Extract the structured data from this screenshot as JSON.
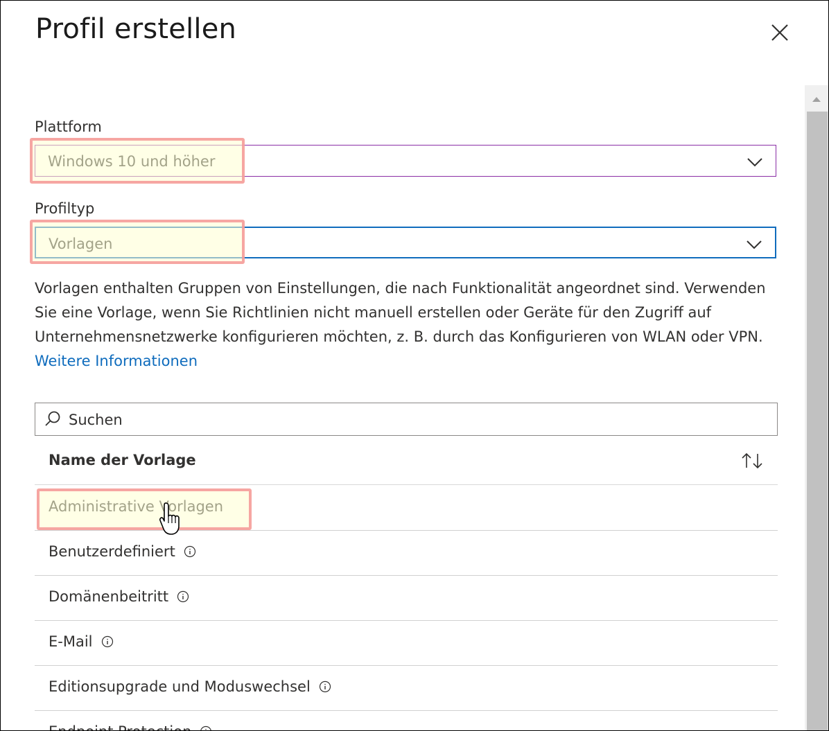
{
  "dialog": {
    "title": "Profil erstellen",
    "close_icon": "close-icon"
  },
  "platform": {
    "label": "Plattform",
    "value": "Windows 10 und höher"
  },
  "profile_type": {
    "label": "Profiltyp",
    "value": "Vorlagen"
  },
  "description": {
    "text": "Vorlagen enthalten Gruppen von Einstellungen, die nach Funktionalität angeordnet sind. Verwenden Sie eine Vorlage, wenn Sie Richtlinien nicht manuell erstellen oder Geräte für den Zugriff auf Unternehmensnetzwerke konfigurieren möchten, z. B. durch das Konfigurieren von WLAN oder VPN. ",
    "link": "Weitere Informationen"
  },
  "search": {
    "placeholder": "Suchen"
  },
  "table": {
    "header": "Name der Vorlage",
    "rows": [
      {
        "name": "Administrative Vorlagen"
      },
      {
        "name": "Benutzerdefiniert"
      },
      {
        "name": "Domänenbeitritt"
      },
      {
        "name": "E-Mail"
      },
      {
        "name": "Editionsupgrade und Moduswechsel"
      },
      {
        "name": "Endpoint Protection"
      }
    ]
  },
  "colors": {
    "link": "#0f6cbd",
    "focus_border": "#0f6cbd",
    "hover_border": "#8a2da5",
    "highlight": "#f49696"
  }
}
